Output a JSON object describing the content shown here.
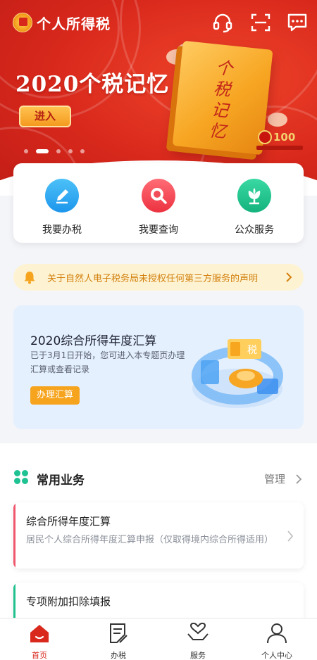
{
  "app": {
    "title": "个人所得税"
  },
  "header": {
    "icons": [
      "headset-icon",
      "scan-icon",
      "message-icon"
    ]
  },
  "banner": {
    "title": "2020个税记忆",
    "button_label": "进入",
    "book_text": "个税记忆",
    "badge_number": "100",
    "slides": 5,
    "active_slide": 2
  },
  "quick_services": [
    {
      "label": "我要办税",
      "icon": "pencil-icon",
      "color": "#21a4f1"
    },
    {
      "label": "我要查询",
      "icon": "search-icon",
      "color": "#f2454f"
    },
    {
      "label": "公众服务",
      "icon": "flower-icon",
      "color": "#1ec08c"
    }
  ],
  "notice": {
    "text": "关于自然人电子税务局未授权任何第三方服务的声明",
    "icon": "bell-icon"
  },
  "promo": {
    "title": "2020综合所得年度汇算",
    "description": "已于3月1日开始，您可进入本专题页办理汇算或查看记录",
    "button_label": "办理汇算",
    "art_label": "税"
  },
  "common": {
    "title": "常用业务",
    "manage_label": "管理",
    "items": [
      {
        "title": "综合所得年度汇算",
        "description": "居民个人综合所得年度汇算申报（仅取得境内综合所得适用）",
        "accent": "#f0566c"
      },
      {
        "title": "专项附加扣除填报",
        "description": "",
        "accent": "#1ec08c"
      }
    ]
  },
  "tabs": [
    {
      "label": "首页",
      "icon": "home-icon",
      "active": true
    },
    {
      "label": "办税",
      "icon": "document-icon",
      "active": false
    },
    {
      "label": "服务",
      "icon": "heart-hands-icon",
      "active": false
    },
    {
      "label": "个人中心",
      "icon": "person-icon",
      "active": false
    }
  ],
  "colors": {
    "brand_red": "#d9281c",
    "accent_orange": "#f6a31d",
    "accent_green": "#1ec08c"
  }
}
